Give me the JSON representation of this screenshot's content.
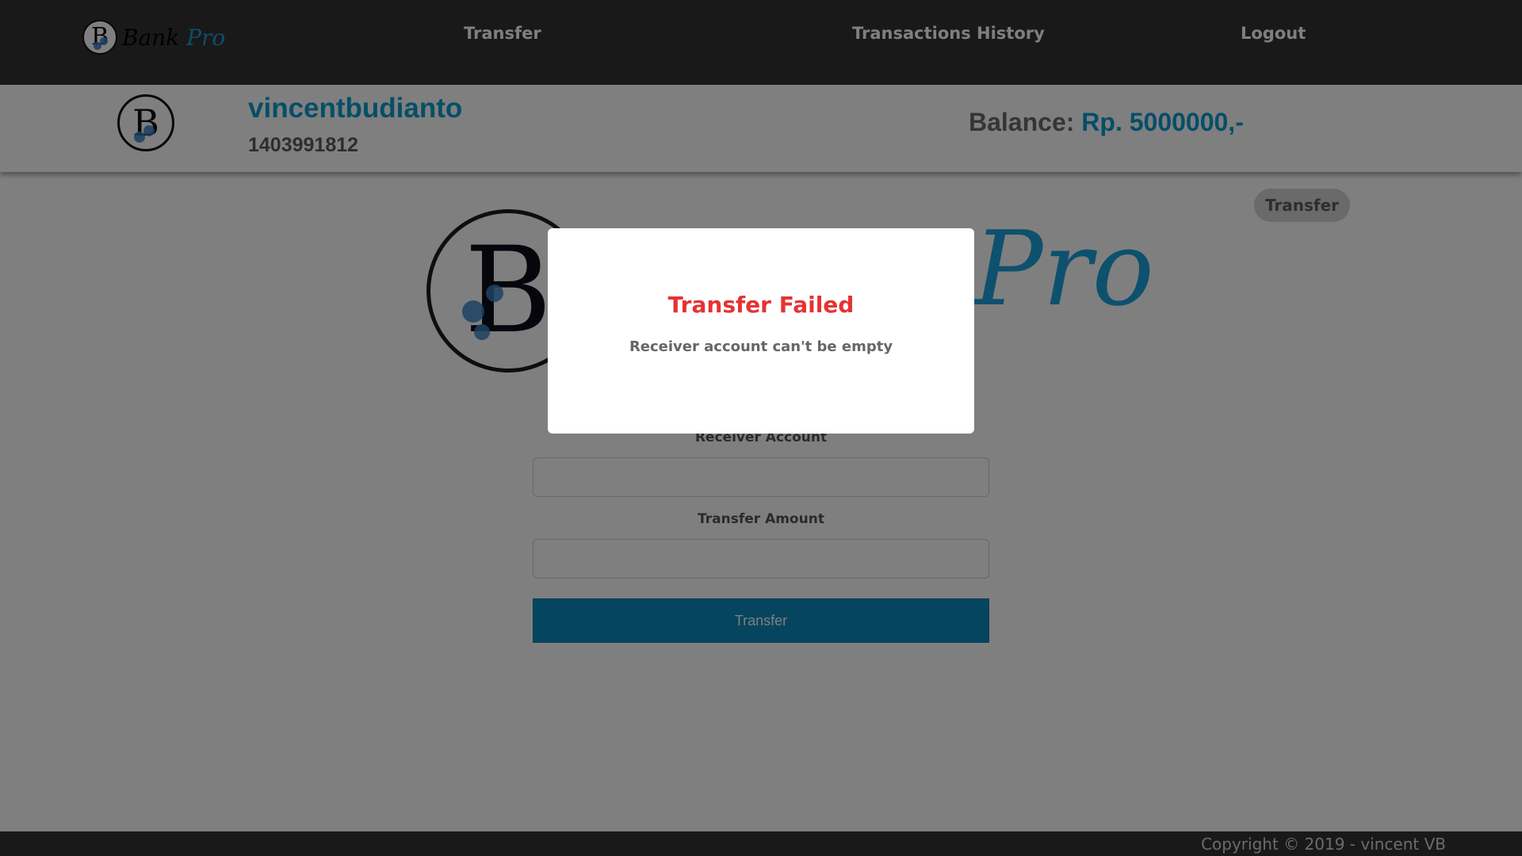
{
  "navbar": {
    "logo_word_1": "Bank",
    "logo_word_2": "Pro",
    "links": [
      "Transfer",
      "Transactions History",
      "Logout"
    ]
  },
  "profile": {
    "username": "vincentbudianto",
    "account_number": "1403991812",
    "balance_label": "Balance:",
    "balance_value": "Rp. 5000000,-"
  },
  "main": {
    "page_badge": "Transfer",
    "hero_word": "Pro",
    "receiver_label": "Receiver Account",
    "receiver_value": "",
    "amount_label": "Transfer Amount",
    "amount_value": "",
    "submit_label": "Transfer"
  },
  "footer": {
    "copyright": "Copyright © 2019 - vincent VB"
  },
  "modal": {
    "title": "Transfer Failed",
    "message": "Receiver account can't be empty"
  },
  "colors": {
    "navbar": "#333333",
    "accent": "#0d9cd1",
    "button": "#0a8bbf",
    "error": "#e53333"
  }
}
